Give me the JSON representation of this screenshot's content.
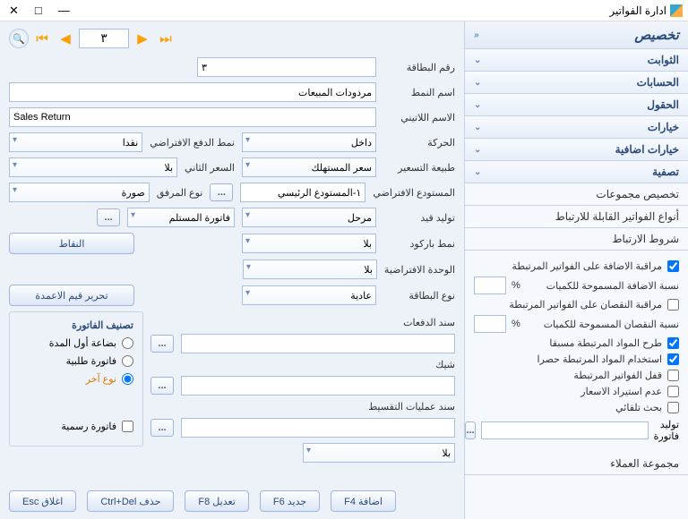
{
  "window": {
    "title": "ادارة الفواتير"
  },
  "nav": {
    "page": "٣"
  },
  "sidebar": {
    "header": "تخصيص",
    "items": [
      "الثوابت",
      "الحسابات",
      "الحقول",
      "خيارات",
      "خيارات اضافية",
      "تصفية"
    ],
    "plain": [
      "تخصيص مجموعات",
      "أنواع الفواتير القابلة للارتباط",
      "شروط الارتباط"
    ],
    "link_panel": {
      "chk_add_watch": "مراقبة الاضافة على الفواتير المرتبطة",
      "pct_add": "نسبة الاضافة المسموحة للكميات",
      "chk_dec_watch": "مراقبة النقصان على الفواتير المرتبطة",
      "pct_dec": "نسبة النقصان المسموحة للكميات",
      "chk_pre_items": "طرح المواد المرتبطة مسبقا",
      "chk_exclusive": "استخدام المواد المرتبطة حصرا",
      "chk_lock": "قفل الفواتير المرتبطة",
      "chk_no_price_import": "عدم استيراد الاسعار",
      "chk_auto_search": "بحث تلقائي",
      "gen_invoice": "توليد فاتورة"
    },
    "customers_group": "مجموعة العملاء",
    "pct": "%"
  },
  "form": {
    "card_no_lbl": "رقم البطاقة",
    "card_no": "٣",
    "pattern_name_lbl": "اسم النمط",
    "pattern_name": "مردودات المبيعات",
    "latin_name_lbl": "الاسم اللاتيني",
    "latin_name": "Sales Return",
    "movement_lbl": "الحركة",
    "movement": "داخل",
    "default_pay_lbl": "نمط الدفع الافتراضي",
    "default_pay": "نقدا",
    "pricing_lbl": "طبيعة التسعير",
    "pricing": "سعر المستهلك",
    "price2_lbl": "السعر الثاني",
    "price2": "بلا",
    "def_store_lbl": "المستودع الافتراضي",
    "def_store": "١-المستودع الرئيسي",
    "attach_type_lbl": "نوع المرفق",
    "attach_type": "صورة",
    "gen_entry_lbl": "توليد قيد",
    "gen_entry": "مرحل",
    "recv_inv_lbl": "فاتورة المستلم",
    "barcode_lbl": "نمط باركود",
    "barcode": "بلا",
    "points_btn": "النقاط",
    "def_unit_lbl": "الوحدة الافتراضية",
    "def_unit": "بلا",
    "card_type_lbl": "نوع البطاقة",
    "card_type": "عادية",
    "edit_cols_btn": "تحرير قيم الاعمدة",
    "payments_doc_lbl": "سند الدفعات",
    "cheque_lbl": "شيك",
    "installment_doc_lbl": "سند عمليات التقسيط",
    "extra_sel": "بلا"
  },
  "classify": {
    "title": "تصنيف الفاتورة",
    "r1": "بضاعة أول المدة",
    "r2": "فاتورة طلبية",
    "r3": "نوع آخر",
    "r4": "فاتورة رسمية"
  },
  "footer": {
    "add": "اضافة F4",
    "new": "جديد F6",
    "edit": "تعديل F8",
    "del": "حذف Ctrl+Del",
    "close": "اغلاق Esc"
  }
}
